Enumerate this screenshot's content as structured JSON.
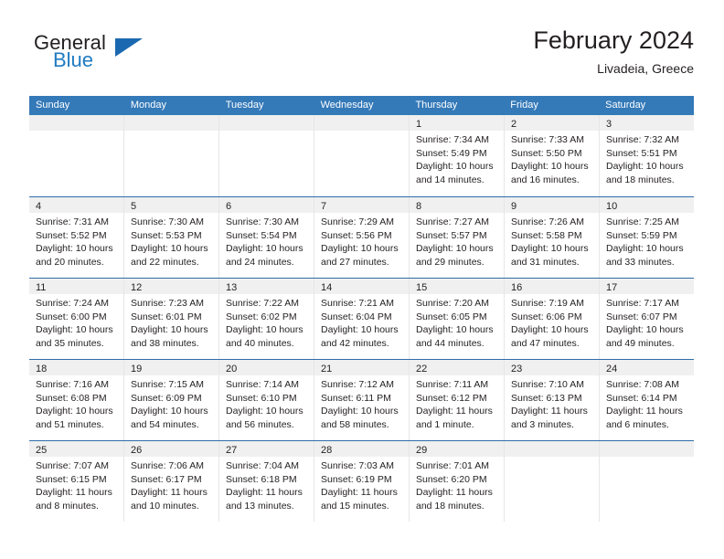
{
  "brand": {
    "word_one": "General",
    "word_two": "Blue",
    "logo_icon": "triangle-logo-icon",
    "blue_hex": "#1f7bc1"
  },
  "header": {
    "month_title": "February 2024",
    "location": "Livadeia, Greece"
  },
  "colors": {
    "header_blue": "#3479b8",
    "daynum_band": "#f0f0f0",
    "text": "#231f20",
    "cell_border": "#e6e6e6"
  },
  "calendar": {
    "weekday_headers": [
      "Sunday",
      "Monday",
      "Tuesday",
      "Wednesday",
      "Thursday",
      "Friday",
      "Saturday"
    ],
    "weeks": [
      [
        {
          "day": "",
          "lines": []
        },
        {
          "day": "",
          "lines": []
        },
        {
          "day": "",
          "lines": []
        },
        {
          "day": "",
          "lines": []
        },
        {
          "day": "1",
          "lines": [
            "Sunrise: 7:34 AM",
            "Sunset: 5:49 PM",
            "Daylight: 10 hours",
            "and 14 minutes."
          ]
        },
        {
          "day": "2",
          "lines": [
            "Sunrise: 7:33 AM",
            "Sunset: 5:50 PM",
            "Daylight: 10 hours",
            "and 16 minutes."
          ]
        },
        {
          "day": "3",
          "lines": [
            "Sunrise: 7:32 AM",
            "Sunset: 5:51 PM",
            "Daylight: 10 hours",
            "and 18 minutes."
          ]
        }
      ],
      [
        {
          "day": "4",
          "lines": [
            "Sunrise: 7:31 AM",
            "Sunset: 5:52 PM",
            "Daylight: 10 hours",
            "and 20 minutes."
          ]
        },
        {
          "day": "5",
          "lines": [
            "Sunrise: 7:30 AM",
            "Sunset: 5:53 PM",
            "Daylight: 10 hours",
            "and 22 minutes."
          ]
        },
        {
          "day": "6",
          "lines": [
            "Sunrise: 7:30 AM",
            "Sunset: 5:54 PM",
            "Daylight: 10 hours",
            "and 24 minutes."
          ]
        },
        {
          "day": "7",
          "lines": [
            "Sunrise: 7:29 AM",
            "Sunset: 5:56 PM",
            "Daylight: 10 hours",
            "and 27 minutes."
          ]
        },
        {
          "day": "8",
          "lines": [
            "Sunrise: 7:27 AM",
            "Sunset: 5:57 PM",
            "Daylight: 10 hours",
            "and 29 minutes."
          ]
        },
        {
          "day": "9",
          "lines": [
            "Sunrise: 7:26 AM",
            "Sunset: 5:58 PM",
            "Daylight: 10 hours",
            "and 31 minutes."
          ]
        },
        {
          "day": "10",
          "lines": [
            "Sunrise: 7:25 AM",
            "Sunset: 5:59 PM",
            "Daylight: 10 hours",
            "and 33 minutes."
          ]
        }
      ],
      [
        {
          "day": "11",
          "lines": [
            "Sunrise: 7:24 AM",
            "Sunset: 6:00 PM",
            "Daylight: 10 hours",
            "and 35 minutes."
          ]
        },
        {
          "day": "12",
          "lines": [
            "Sunrise: 7:23 AM",
            "Sunset: 6:01 PM",
            "Daylight: 10 hours",
            "and 38 minutes."
          ]
        },
        {
          "day": "13",
          "lines": [
            "Sunrise: 7:22 AM",
            "Sunset: 6:02 PM",
            "Daylight: 10 hours",
            "and 40 minutes."
          ]
        },
        {
          "day": "14",
          "lines": [
            "Sunrise: 7:21 AM",
            "Sunset: 6:04 PM",
            "Daylight: 10 hours",
            "and 42 minutes."
          ]
        },
        {
          "day": "15",
          "lines": [
            "Sunrise: 7:20 AM",
            "Sunset: 6:05 PM",
            "Daylight: 10 hours",
            "and 44 minutes."
          ]
        },
        {
          "day": "16",
          "lines": [
            "Sunrise: 7:19 AM",
            "Sunset: 6:06 PM",
            "Daylight: 10 hours",
            "and 47 minutes."
          ]
        },
        {
          "day": "17",
          "lines": [
            "Sunrise: 7:17 AM",
            "Sunset: 6:07 PM",
            "Daylight: 10 hours",
            "and 49 minutes."
          ]
        }
      ],
      [
        {
          "day": "18",
          "lines": [
            "Sunrise: 7:16 AM",
            "Sunset: 6:08 PM",
            "Daylight: 10 hours",
            "and 51 minutes."
          ]
        },
        {
          "day": "19",
          "lines": [
            "Sunrise: 7:15 AM",
            "Sunset: 6:09 PM",
            "Daylight: 10 hours",
            "and 54 minutes."
          ]
        },
        {
          "day": "20",
          "lines": [
            "Sunrise: 7:14 AM",
            "Sunset: 6:10 PM",
            "Daylight: 10 hours",
            "and 56 minutes."
          ]
        },
        {
          "day": "21",
          "lines": [
            "Sunrise: 7:12 AM",
            "Sunset: 6:11 PM",
            "Daylight: 10 hours",
            "and 58 minutes."
          ]
        },
        {
          "day": "22",
          "lines": [
            "Sunrise: 7:11 AM",
            "Sunset: 6:12 PM",
            "Daylight: 11 hours",
            "and 1 minute."
          ]
        },
        {
          "day": "23",
          "lines": [
            "Sunrise: 7:10 AM",
            "Sunset: 6:13 PM",
            "Daylight: 11 hours",
            "and 3 minutes."
          ]
        },
        {
          "day": "24",
          "lines": [
            "Sunrise: 7:08 AM",
            "Sunset: 6:14 PM",
            "Daylight: 11 hours",
            "and 6 minutes."
          ]
        }
      ],
      [
        {
          "day": "25",
          "lines": [
            "Sunrise: 7:07 AM",
            "Sunset: 6:15 PM",
            "Daylight: 11 hours",
            "and 8 minutes."
          ]
        },
        {
          "day": "26",
          "lines": [
            "Sunrise: 7:06 AM",
            "Sunset: 6:17 PM",
            "Daylight: 11 hours",
            "and 10 minutes."
          ]
        },
        {
          "day": "27",
          "lines": [
            "Sunrise: 7:04 AM",
            "Sunset: 6:18 PM",
            "Daylight: 11 hours",
            "and 13 minutes."
          ]
        },
        {
          "day": "28",
          "lines": [
            "Sunrise: 7:03 AM",
            "Sunset: 6:19 PM",
            "Daylight: 11 hours",
            "and 15 minutes."
          ]
        },
        {
          "day": "29",
          "lines": [
            "Sunrise: 7:01 AM",
            "Sunset: 6:20 PM",
            "Daylight: 11 hours",
            "and 18 minutes."
          ]
        },
        {
          "day": "",
          "lines": []
        },
        {
          "day": "",
          "lines": []
        }
      ]
    ]
  }
}
